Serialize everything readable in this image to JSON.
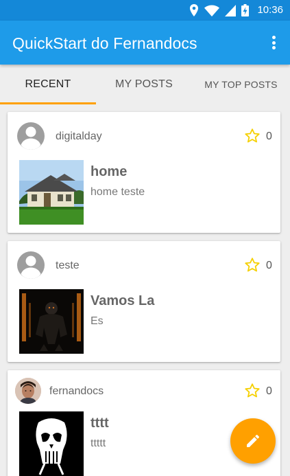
{
  "status_bar": {
    "time": "10:36"
  },
  "app_bar": {
    "title": "QuickStart do Fernandocs"
  },
  "tabs": [
    {
      "label": "RECENT",
      "selected": true
    },
    {
      "label": "MY POSTS",
      "selected": false
    },
    {
      "label": "MY TOP POSTS",
      "selected": false
    }
  ],
  "posts": [
    {
      "author": "digitalday",
      "stars": "0",
      "title": "home",
      "body": "home teste",
      "thumbnail": "house-photo"
    },
    {
      "author": "teste",
      "stars": "0",
      "title": "Vamos La",
      "body": "Es",
      "thumbnail": "dark-soldier-art"
    },
    {
      "author": "fernandocs",
      "stars": "0",
      "title": "tttt",
      "body": "ttttt",
      "thumbnail": "punisher-skull"
    }
  ],
  "colors": {
    "primary": "#1e9be9",
    "primary_dark": "#1488d8",
    "accent": "#ffa000",
    "star": "#f5d000"
  },
  "icons": {
    "fab": "edit-pencil-icon",
    "star": "star-outline-icon",
    "menu": "more-vert-icon"
  }
}
